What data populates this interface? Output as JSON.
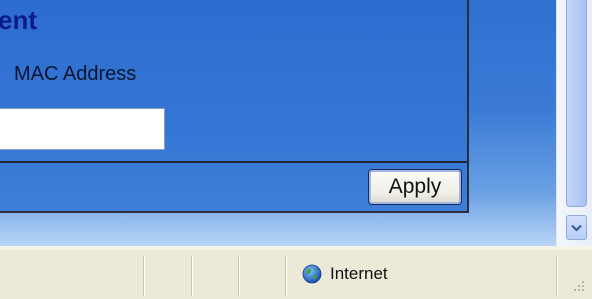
{
  "panel": {
    "heading_fragment": "ent",
    "mac_label": "MAC Address",
    "mac_value": "",
    "apply_label": "Apply"
  },
  "statusbar": {
    "zone_icon": "globe-icon",
    "zone_label": "Internet"
  },
  "colors": {
    "content_blue": "#3a78d0",
    "heading_navy": "#0c1a8a",
    "statusbar_bg": "#ece9d8",
    "scrollbar_thumb": "#b6cbf5"
  }
}
